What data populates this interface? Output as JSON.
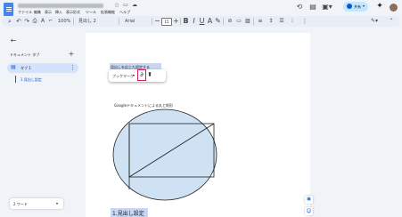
{
  "app": {
    "brand_color": "#4285f4",
    "accent_color": "#0b57d0"
  },
  "header": {
    "star_icon": "star-outline-icon",
    "move_icon": "folder-move-icon",
    "cloud_icon": "cloud-check-icon",
    "menu": [
      "ファイル",
      "編集",
      "表示",
      "挿入",
      "表示形式",
      "ツール",
      "拡張機能",
      "ヘルプ"
    ],
    "share_label": "共有"
  },
  "toolbar": {
    "zoom": "100%",
    "style": "見出し 2",
    "font": "Arial",
    "font_size": "15"
  },
  "sidebar": {
    "section_title": "ドキュメント タブ",
    "tab_label": "タブ 1",
    "outline_item": "1.見出し設定",
    "word_count": "2 ワード"
  },
  "document": {
    "heading_popup_text": "見出しを応じた設定する",
    "popup_dropdown": "ブックマーク",
    "popup_icon": "link-icon",
    "figure_caption": "Googleドキュメントによる丸と矩形",
    "bottom_heading": "1.見出し設定"
  },
  "colors": {
    "highlight": "#c6d6f4",
    "ellipse_fill": "#cfe2f3",
    "popup_border": "#d6205a"
  }
}
